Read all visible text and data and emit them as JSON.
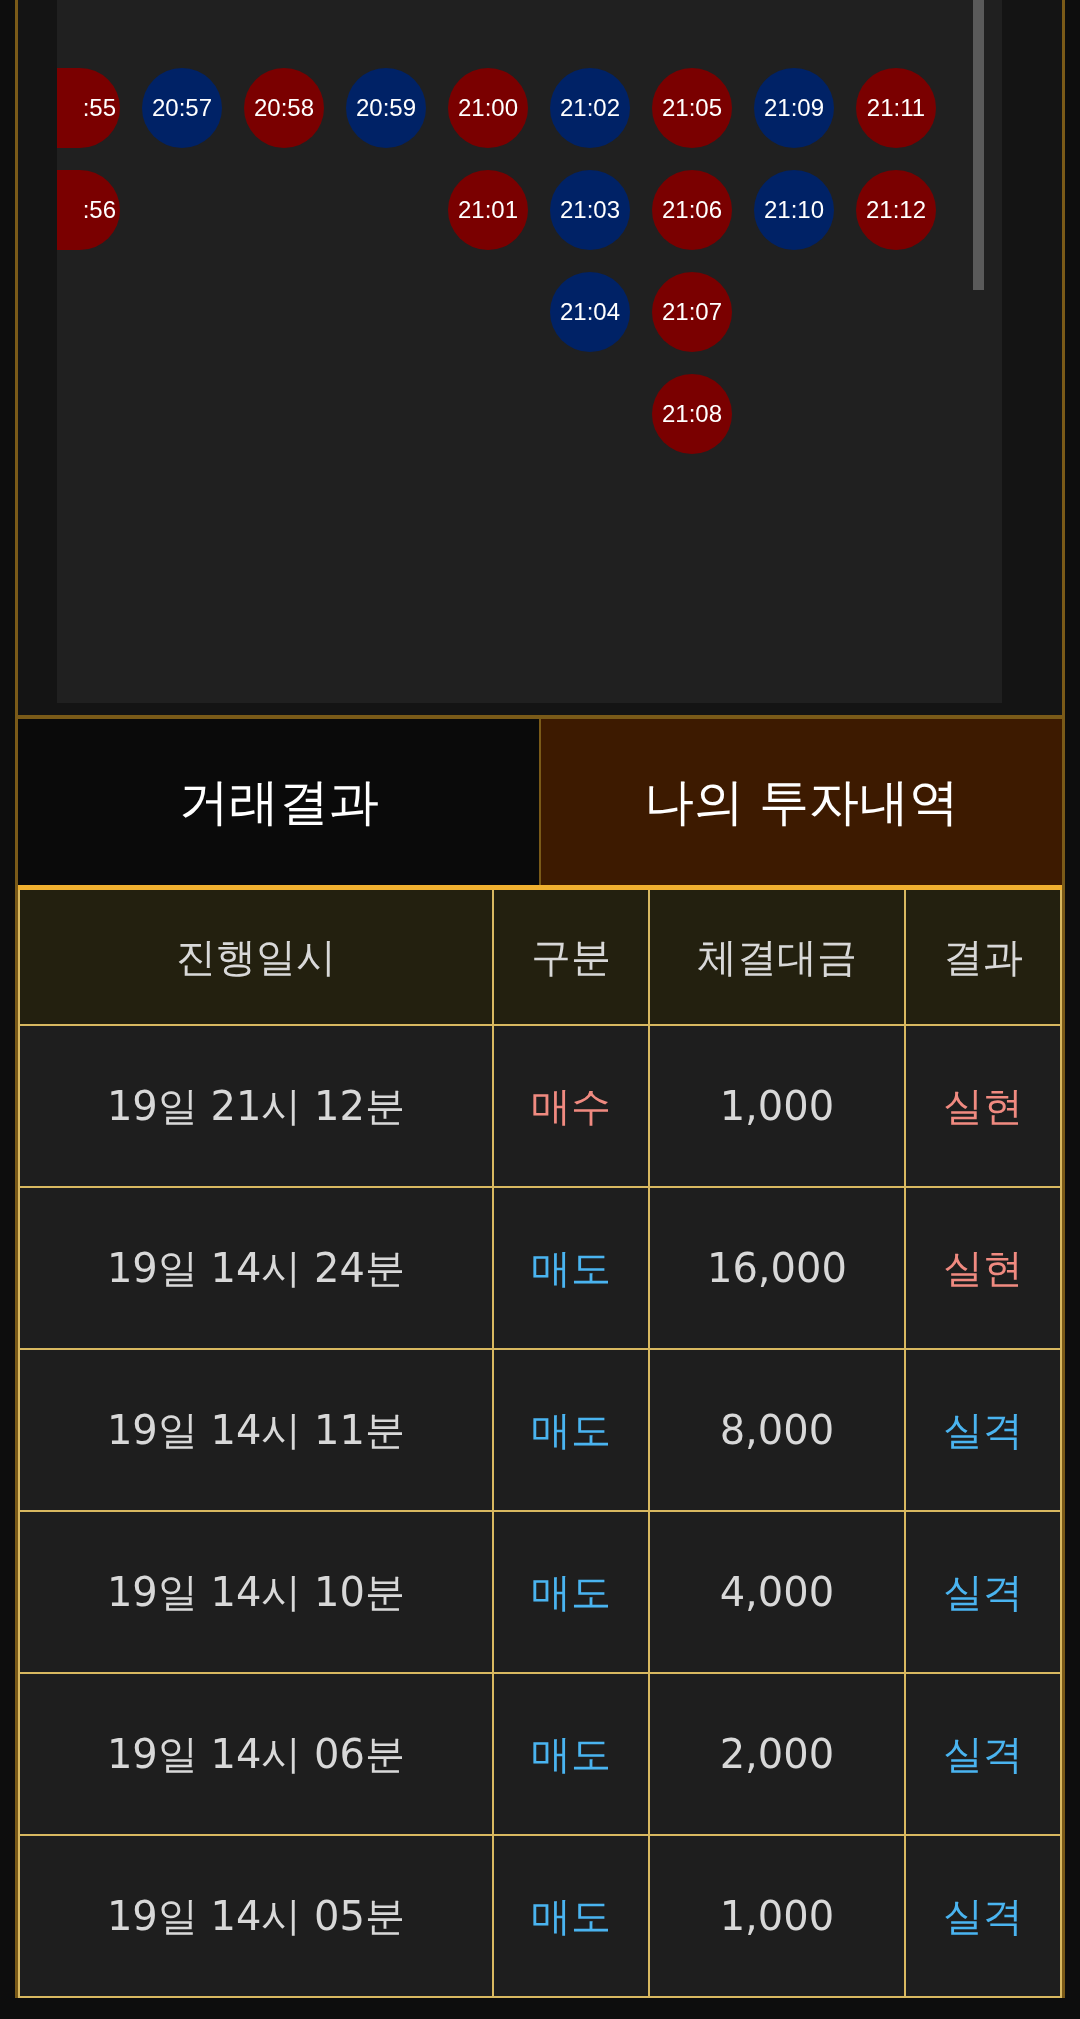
{
  "chart_columns": [
    {
      "cut": true,
      "circles": [
        {
          "time": ":55",
          "color": "#7a0000"
        },
        {
          "time": ":56",
          "color": "#7a0000"
        }
      ]
    },
    {
      "cut": false,
      "circles": [
        {
          "time": "20:57",
          "color": "#002266"
        }
      ]
    },
    {
      "cut": false,
      "circles": [
        {
          "time": "20:58",
          "color": "#7a0000"
        }
      ]
    },
    {
      "cut": false,
      "circles": [
        {
          "time": "20:59",
          "color": "#002266"
        }
      ]
    },
    {
      "cut": false,
      "circles": [
        {
          "time": "21:00",
          "color": "#7a0000"
        },
        {
          "time": "21:01",
          "color": "#7a0000"
        }
      ]
    },
    {
      "cut": false,
      "circles": [
        {
          "time": "21:02",
          "color": "#002266"
        },
        {
          "time": "21:03",
          "color": "#002266"
        },
        {
          "time": "21:04",
          "color": "#002266"
        }
      ]
    },
    {
      "cut": false,
      "circles": [
        {
          "time": "21:05",
          "color": "#7a0000"
        },
        {
          "time": "21:06",
          "color": "#7a0000"
        },
        {
          "time": "21:07",
          "color": "#7a0000"
        },
        {
          "time": "21:08",
          "color": "#7a0000"
        }
      ]
    },
    {
      "cut": false,
      "circles": [
        {
          "time": "21:09",
          "color": "#002266"
        },
        {
          "time": "21:10",
          "color": "#002266"
        }
      ]
    },
    {
      "cut": false,
      "circles": [
        {
          "time": "21:11",
          "color": "#7a0000"
        },
        {
          "time": "21:12",
          "color": "#7a0000"
        }
      ]
    }
  ],
  "tabs": [
    {
      "label": "거래결과",
      "selected": false
    },
    {
      "label": "나의 투자내역",
      "selected": true
    }
  ],
  "table": {
    "columns": [
      "진행일시",
      "구분",
      "체결대금",
      "결과"
    ],
    "rows": [
      {
        "date": "19일 21시 12분",
        "type": {
          "text": "매수",
          "color": "#f08a80"
        },
        "amount": "1,000",
        "result": {
          "text": "실현",
          "color": "#f08a80"
        }
      },
      {
        "date": "19일 14시 24분",
        "type": {
          "text": "매도",
          "color": "#4ab4f0"
        },
        "amount": "16,000",
        "result": {
          "text": "실현",
          "color": "#f08a80"
        }
      },
      {
        "date": "19일 14시 11분",
        "type": {
          "text": "매도",
          "color": "#4ab4f0"
        },
        "amount": "8,000",
        "result": {
          "text": "실격",
          "color": "#4ab4f0"
        }
      },
      {
        "date": "19일 14시 10분",
        "type": {
          "text": "매도",
          "color": "#4ab4f0"
        },
        "amount": "4,000",
        "result": {
          "text": "실격",
          "color": "#4ab4f0"
        }
      },
      {
        "date": "19일 14시 06분",
        "type": {
          "text": "매도",
          "color": "#4ab4f0"
        },
        "amount": "2,000",
        "result": {
          "text": "실격",
          "color": "#4ab4f0"
        }
      },
      {
        "date": "19일 14시 05분",
        "type": {
          "text": "매도",
          "color": "#4ab4f0"
        },
        "amount": "1,000",
        "result": {
          "text": "실격",
          "color": "#4ab4f0"
        }
      }
    ]
  }
}
